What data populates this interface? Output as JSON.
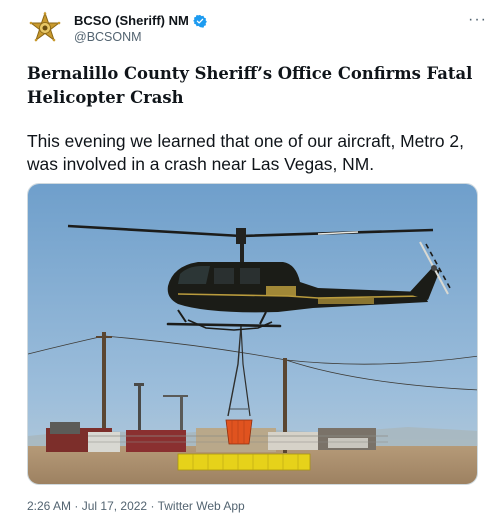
{
  "tweet": {
    "display_name": "BCSO (Sheriff) NM",
    "handle": "@BCSONM",
    "headline": "Bernalillo County Sheriff’s Office Confirms Fatal Helicopter Crash",
    "body": "This evening we learned that one of our aircraft, Metro 2, was involved in a crash near Las Vegas, NM.",
    "time": "2:26 AM",
    "date": "Jul 17, 2022",
    "source": "Twitter Web App",
    "separator": "·"
  },
  "icons": {
    "avatar": "sheriff-star-badge",
    "verified": "verified-badge-icon",
    "more": "more-options-icon"
  },
  "colors": {
    "verified_blue": "#1d9bf0",
    "secondary_text": "#536471",
    "sky": "#7aa7cf",
    "helicopter_body": "#1b1c17",
    "bucket": "#e0531f"
  }
}
